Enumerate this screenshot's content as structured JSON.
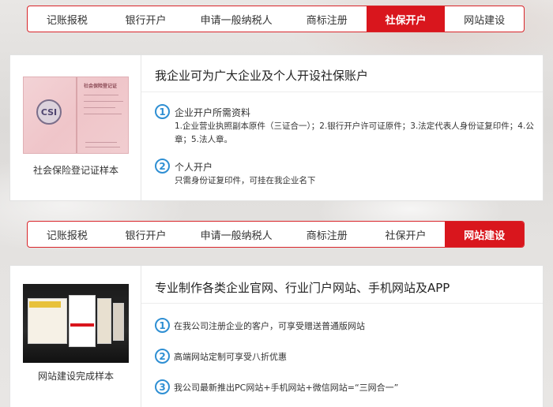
{
  "tabs": {
    "items": [
      "记账报税",
      "银行开户",
      "申请一般纳税人",
      "商标注册",
      "社保开户",
      "网站建设"
    ]
  },
  "section_social": {
    "active_tab": "社保开户",
    "image_caption": "社会保险登记证样本",
    "title": "我企业可为广大企业及个人开设社保账户",
    "items": [
      {
        "number": "1",
        "heading": "企业开户所需资料",
        "body": "1.企业营业执照副本原件（三证合一）；2.银行开户许可证原件；3.法定代表人身份证复印件；4.公章；5.法人章。"
      },
      {
        "number": "2",
        "heading": "个人开户",
        "body": "只需身份证复印件，可挂在我企业名下"
      }
    ],
    "cert_title": "社会保险登记证",
    "cert_seal": "CSI"
  },
  "section_web": {
    "active_tab": "网站建设",
    "image_caption": "网站建设完成样本",
    "title": "专业制作各类企业官网、行业门户网站、手机网站及APP",
    "items": [
      {
        "number": "1",
        "text": "在我公司注册企业的客户，可享受赠送普通版网站"
      },
      {
        "number": "2",
        "text": "高端网站定制可享受八折优惠"
      },
      {
        "number": "3",
        "text": "我公司最新推出PC网站+手机网站+微信网站=“三网合一”"
      }
    ]
  },
  "colors": {
    "accent": "#d9161d",
    "number_blue": "#2f8fd3"
  }
}
